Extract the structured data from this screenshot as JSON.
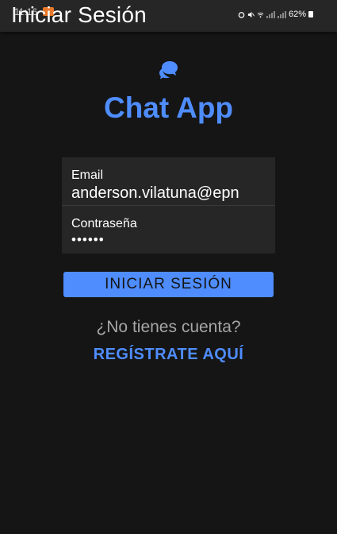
{
  "status_bar": {
    "time": "11:16",
    "battery": "62%",
    "icons": [
      "alarm-icon",
      "mute-icon",
      "wifi-icon",
      "signal-icon",
      "signal-icon",
      "battery-icon"
    ]
  },
  "app_bar": {
    "title": "Iniciar Sesión"
  },
  "logo": {
    "icon": "chat-bubbles-icon"
  },
  "app_title": "Chat App",
  "form": {
    "email_label": "Email",
    "email_value": "anderson.vilatuna@epn",
    "password_label": "Contraseña",
    "password_value": "••••••"
  },
  "login_button": "INICIAR SESIÓN",
  "no_account_text": "¿No tienes cuenta?",
  "register_link": "REGÍSTRATE AQUÍ",
  "colors": {
    "background": "#151515",
    "surface": "#262626",
    "accent": "#4f8dff",
    "muted_text": "#a6a6a6"
  }
}
